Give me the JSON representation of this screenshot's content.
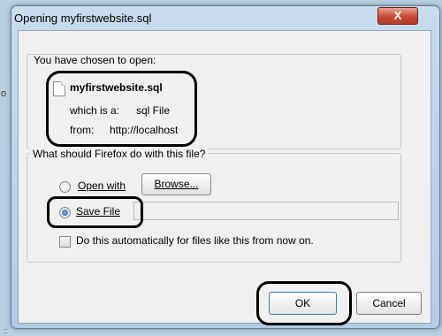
{
  "window": {
    "title": "Opening myfirstwebsite.sql",
    "close_label": "X"
  },
  "file_info": {
    "caption": "You have chosen to open:",
    "filename": "myfirstwebsite.sql",
    "type_label": "which is a:",
    "type_value": "sql File",
    "from_label": "from:",
    "from_value": "http://localhost"
  },
  "action_group": {
    "caption": "What should Firefox do with this file?",
    "open_with_label": "Open with",
    "browse_label": "Browse...",
    "save_file_label": "Save File",
    "save_selected": true,
    "auto_label": "Do this automatically for files like this from now on.",
    "auto_checked": false
  },
  "buttons": {
    "ok": "OK",
    "cancel": "Cancel"
  },
  "edge_fragments": {
    "left": "o",
    "bottom": "::"
  },
  "colors": {
    "accent": "#1b5eb4",
    "close_button": "#c74a32",
    "annotation": "#000000"
  }
}
